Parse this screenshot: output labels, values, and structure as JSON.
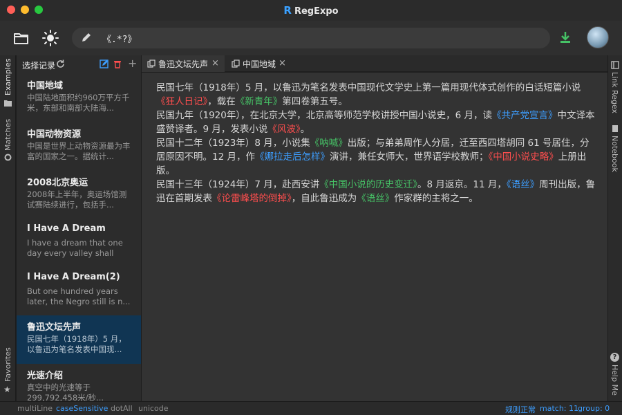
{
  "window": {
    "title": "RegExpo",
    "logo": "R"
  },
  "toolbar": {
    "open_icon": "folder-icon",
    "theme_icon": "sun-icon",
    "edit_icon": "pencil-icon",
    "regex": "《.*?》",
    "download_icon": "download-icon"
  },
  "leftbar": {
    "examples": "Examples",
    "matches": "Matches",
    "favorites": "Favorites"
  },
  "sidebar": {
    "title": "选择记录",
    "items": [
      {
        "title": "中国地域",
        "preview": "中国陆地面积约960万平方千米，东部和南部大陆海..."
      },
      {
        "title": "中国动物资源",
        "preview": "中国是世界上动物资源最为丰富的国家之一。据统计..."
      },
      {
        "title": "2008北京奥运",
        "preview": "2008年上半年，奥运场馆测试赛陆续进行，包括手..."
      },
      {
        "title": "I Have A Dream",
        "preview": "I have a dream that one day every valley shall be..."
      },
      {
        "title": "I Have A Dream(2)",
        "preview": "But one hundred years later, the Negro still is n..."
      },
      {
        "title": "鲁迅文坛先声",
        "preview": "民国七年（1918年）5 月，以鲁迅为笔名发表中国现..."
      },
      {
        "title": "光速介绍",
        "preview": "真空中的光速等于299,792,458米/秒..."
      }
    ]
  },
  "tabs": [
    {
      "label": "鲁迅文坛先声",
      "close": "×"
    },
    {
      "label": "中国地域",
      "close": "×"
    }
  ],
  "editor": {
    "paragraphs": [
      [
        {
          "t": "民国七年（1918年）5 月，以鲁迅为笔名发表中国现代文学史上第一篇用现代体式创作的白话短篇小说"
        },
        {
          "t": "《狂人日记》",
          "c": "red"
        },
        {
          "t": "，载在"
        },
        {
          "t": "《新青年》",
          "c": "green"
        },
        {
          "t": "第四卷第五号。"
        }
      ],
      [
        {
          "t": "民国九年（1920年），在北京大学，北京高等师范学校讲授中国小说史，6 月，读"
        },
        {
          "t": "《共产党宣言》",
          "c": "blue"
        },
        {
          "t": "中文译本盛赞译者。9 月，发表小说"
        },
        {
          "t": "《风波》",
          "c": "red"
        },
        {
          "t": "。"
        }
      ],
      [
        {
          "t": "民国十二年（1923年）8 月，小说集"
        },
        {
          "t": "《呐喊》",
          "c": "green"
        },
        {
          "t": "出版；与弟弟周作人分居，迁至西四塔胡同 61 号居住，分居原因不明。12 月，作"
        },
        {
          "t": "《娜拉走后怎样》",
          "c": "blue"
        },
        {
          "t": "演讲，兼任女师大，世界语学校教师；"
        },
        {
          "t": "《中国小说史略》",
          "c": "red"
        },
        {
          "t": "上册出版。"
        }
      ],
      [
        {
          "t": "民国十三年（1924年）7 月，赴西安讲"
        },
        {
          "t": "《中国小说的历史变迁》",
          "c": "green"
        },
        {
          "t": "。8 月返京。11 月，"
        },
        {
          "t": "《语丝》",
          "c": "blue"
        },
        {
          "t": "周刊出版，鲁迅在首期发表"
        },
        {
          "t": "《论雷峰塔的倒掉》",
          "c": "red"
        },
        {
          "t": "，自此鲁迅成为"
        },
        {
          "t": "《语丝》",
          "c": "green"
        },
        {
          "t": "作家群的主将之一。"
        }
      ]
    ]
  },
  "rightbar": {
    "link_regex": "Link Regex",
    "notebook": "Notebook",
    "help": "Help Me"
  },
  "status": {
    "multiline": "multiLine",
    "case_sensitive": "caseSensitive",
    "dotall": "dotAll",
    "unicode": "unicode",
    "regex_ok": "规则正常",
    "match": "match: 11",
    "group": "group: 0"
  },
  "colors": {
    "accent": "#3d9eff",
    "match_red": "#ff4e4e",
    "match_green": "#46c266",
    "match_blue": "#3d9eff",
    "active_item": "#103553"
  }
}
